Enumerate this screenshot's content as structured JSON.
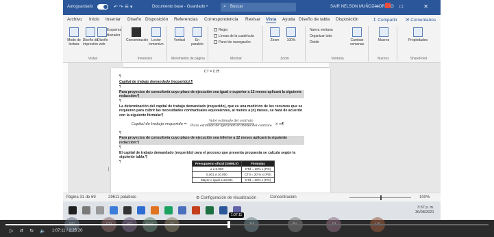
{
  "window": {
    "autosave_label": "Autoguardado",
    "quick_access": "↶ ↷ ☰ ▾",
    "doc_title": "Documento base - Guardado •",
    "search_placeholder": "Buscar",
    "user": "SAIR NELSON MUÑOZ MORENO",
    "win_buttons": "— □ ✕"
  },
  "ribbon": {
    "tabs": [
      "Archivo",
      "Inicio",
      "Insertar",
      "Diseño",
      "Disposición",
      "Referencias",
      "Correspondencia",
      "Revisar",
      "Vista",
      "Ayuda",
      "Diseño de tabla",
      "Disposición"
    ],
    "active_tab": "Vista",
    "share": "↥ Compartir",
    "comments": "✉ Comentarios",
    "groups": {
      "vistas": {
        "label": "Vistas",
        "modo_lectura": "Modo de lectura",
        "diseno_impresion": "Diseño de impresión",
        "diseno_web": "Diseño web",
        "esquema": "Esquema",
        "borrador": "Borrador"
      },
      "inmersivo": {
        "label": "Inmersivo",
        "concentracion": "Concentración",
        "lector": "Lector inmersivo"
      },
      "movimiento": {
        "label": "Movimiento de página",
        "vertical": "Vertical",
        "en_paralelo": "En paralelo"
      },
      "mostrar": {
        "label": "Mostrar",
        "regla": "Regla",
        "cuadricula": "Líneas de la cuadrícula",
        "panel": "Panel de navegación"
      },
      "zoom": {
        "label": "Zoom",
        "zoom": "Zoom",
        "cien": "100%"
      },
      "ventana": {
        "label": "Ventana",
        "nueva": "Nueva ventana",
        "organizar": "Organizar todo",
        "dividir": "Dividir",
        "cambiar": "Cambiar ventanas"
      },
      "macros": {
        "label": "Macros",
        "macros": "Macros"
      },
      "sharepoint": {
        "label": "SharePoint",
        "propiedades": "Propiedades"
      }
    }
  },
  "document": {
    "line_ct": "CT = C1¶",
    "pilcrow": "¶",
    "heading": "Capital de trabajo demandado (requerido).¶",
    "p1": "Para proyectos de consultoría cuyo plazo de ejecución sea igual o superior a 12 meses aplicará la siguiente redacción:¶",
    "p2": "La determinación del capital de trabajo demandado (requerido), que es una medición de los recursos que se requieren para cubrir las necesidades contractuales equivalentes, al menos a (n) meses, se hará de acuerdo con la siguiente fórmula:¶",
    "formula_lhs": "Capital de trabajo requerido =",
    "formula_num": "Valor estimado del contrato",
    "formula_den": "Plazo estimado de ejecución en meses del contrato",
    "formula_rhs": "× n¶",
    "p3": "Para proyectos de consultoría cuyo plazo de ejecución sea inferior a 12 meses aplicará la siguiente redacción:¶",
    "p4": "El capital de trabajo demandado (requerido) para el proceso que presenta propuesta se calcula según la siguiente tabla:¶",
    "table": {
      "headers": [
        "Presupuesto oficial (SMMLV)",
        "Fórmulas"
      ],
      "rows": [
        [
          "≤ a 5.000",
          "CTd = 10% x (PO)"
        ],
        [
          "5.001 a 10.000",
          "CTd = 20 % x (PO)"
        ],
        [
          "Mayor o igual a 10.001",
          "CTd = 30% x (PO)"
        ]
      ]
    }
  },
  "statusbar": {
    "page": "Página 31 de 69",
    "words": "29611 palabras",
    "display_settings": "⚙ Configuración de visualización",
    "focus": "Concentración",
    "zoom": "100%"
  },
  "taskbar": {
    "time": "3:37 p. m.",
    "date": "30/08/2021"
  },
  "video": {
    "current_time": "1:07:11",
    "duration": "2:25:20",
    "tooltip": "1:07:11",
    "progress": 0.462,
    "participants": [
      "PD",
      "CP",
      "YD",
      "SMC",
      "JC",
      "JM",
      "BL",
      "JP",
      "LF"
    ]
  }
}
